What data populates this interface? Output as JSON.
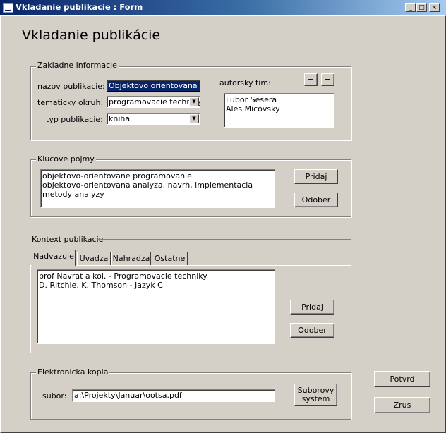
{
  "window": {
    "title": "Vkladanie publikacie : Form",
    "minimize_glyph": "_",
    "maximize_glyph": "□",
    "close_glyph": "×"
  },
  "form_title": "Vkladanie publikácie",
  "zakladne": {
    "legend": "Zakladne informacie",
    "nazov_label": "nazov publikacie:",
    "nazov_value": "Objektovo orientovana tvo",
    "okruh_label": "tematicky okruh:",
    "okruh_value": "programovacie techniky",
    "typ_label": "typ publikacie:",
    "typ_value": "kniha",
    "autorsky_label": "autorsky tim:",
    "add_label": "+",
    "remove_label": "−",
    "autori": [
      "Lubor Sesera",
      "Ales Micovsky"
    ]
  },
  "klucove": {
    "legend": "Klucove pojmy",
    "items": [
      "objektovo-orientovane programovanie",
      "objektovo-orientovana analyza, navrh, implementacia",
      "metody analyzy"
    ],
    "pridaj_label": "Pridaj",
    "odober_label": "Odober"
  },
  "kontext": {
    "heading": "Kontext publikacie",
    "tabs": [
      "Nadvazuje",
      "Uvadza",
      "Nahradza",
      "Ostatne"
    ],
    "active_tab": "Nadvazuje",
    "items": [
      "prof Navrat a kol. -  Programovacie techniky",
      "D. Ritchie, K. Thomson - Jazyk C"
    ],
    "pridaj_label": "Pridaj",
    "odober_label": "Odober"
  },
  "elektronicka": {
    "legend": "Elektronicka kopia",
    "subor_label": "subor:",
    "subor_value": "a:\\Projekty\\Januar\\ootsa.pdf",
    "browse_label_line1": "Suborovy",
    "browse_label_line2": "system"
  },
  "actions": {
    "potvrd_label": "Potvrd",
    "zrus_label": "Zrus"
  },
  "icons": {
    "combo_arrow": "▼"
  }
}
